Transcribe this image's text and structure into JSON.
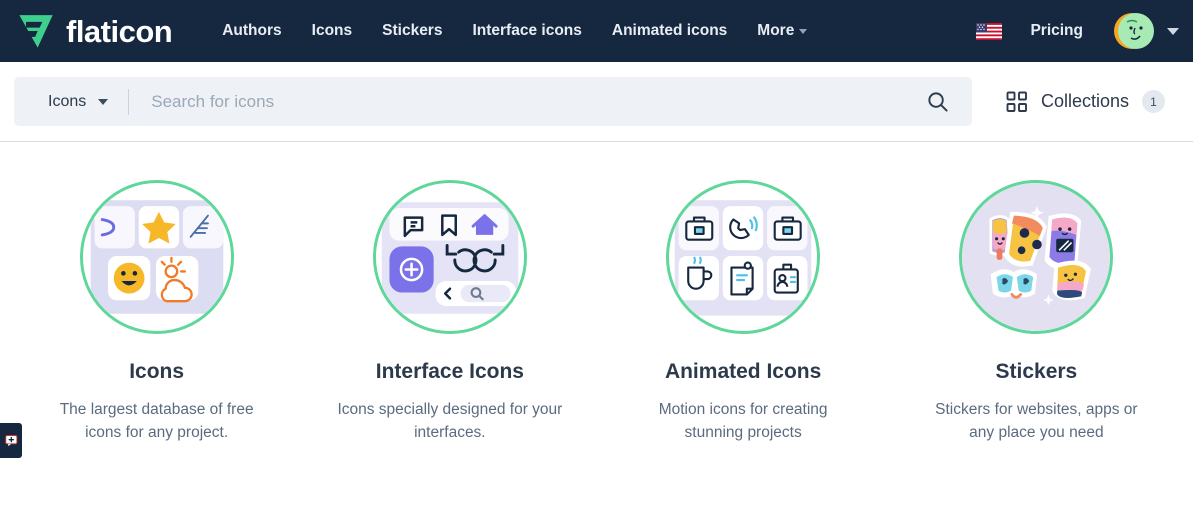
{
  "header": {
    "brand_name": "flaticon",
    "brand_logo_icon": "flaticon-logo-icon",
    "nav": [
      {
        "label": "Authors",
        "has_caret": false
      },
      {
        "label": "Icons",
        "has_caret": false
      },
      {
        "label": "Stickers",
        "has_caret": false
      },
      {
        "label": "Interface icons",
        "has_caret": false
      },
      {
        "label": "Animated icons",
        "has_caret": false
      },
      {
        "label": "More",
        "has_caret": true
      }
    ],
    "flag_icon": "us-flag-icon",
    "pricing_label": "Pricing",
    "avatar_icon": "user-avatar-icon",
    "avatar_caret_icon": "chevron-down-icon"
  },
  "search": {
    "type_label": "Icons",
    "type_caret_icon": "chevron-down-icon",
    "placeholder": "Search for icons",
    "value": "",
    "search_icon": "search-icon"
  },
  "collections": {
    "grid_icon": "grid-icon",
    "label": "Collections",
    "count": "1"
  },
  "cards": [
    {
      "title": "Icons",
      "description": "The largest database of free icons for any project.",
      "thumb_icon": "icons-grid-thumb-icon"
    },
    {
      "title": "Interface Icons",
      "description": "Icons specially designed for your interfaces.",
      "thumb_icon": "interface-icons-thumb-icon"
    },
    {
      "title": "Animated Icons",
      "description": "Motion icons for creating stunning projects",
      "thumb_icon": "animated-icons-thumb-icon"
    },
    {
      "title": "Stickers",
      "description": "Stickers for websites, apps or any place you need",
      "thumb_icon": "stickers-thumb-icon"
    }
  ],
  "edge_widget": {
    "icon": "feedback-tab-icon"
  },
  "colors": {
    "header_bg": "#16283f",
    "accent_green": "#5fd79a",
    "search_bg": "#eef2f6",
    "text_dark": "#2c3a4b",
    "text_muted": "#5b6b7e"
  }
}
